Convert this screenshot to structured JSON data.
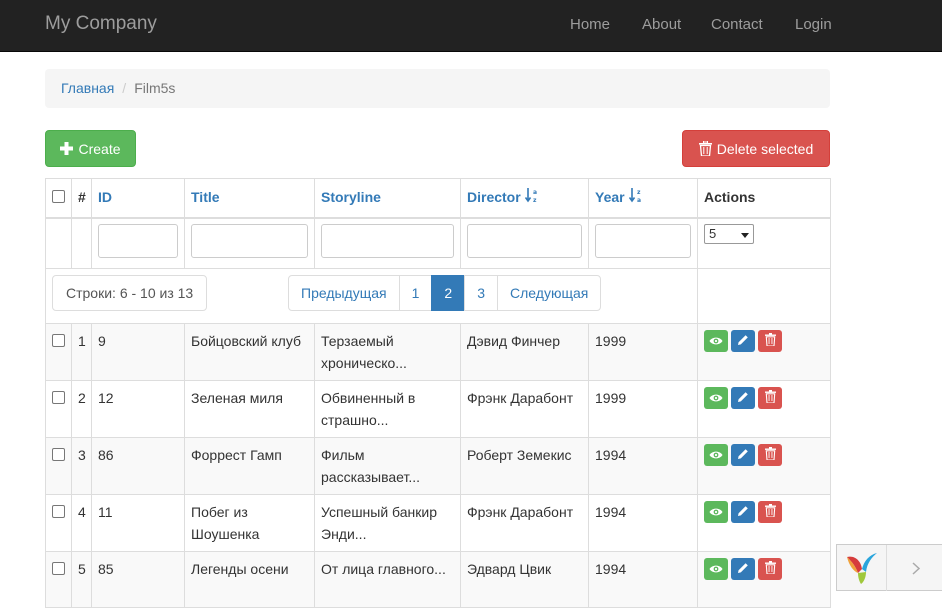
{
  "navbar": {
    "brand": "My Company",
    "links": [
      "Home",
      "About",
      "Contact",
      "Login"
    ]
  },
  "breadcrumb": {
    "home": "Главная",
    "current": "Film5s"
  },
  "toolbar": {
    "create_label": "Create",
    "delete_label": "Delete selected"
  },
  "table": {
    "headers": {
      "num": "#",
      "id": "ID",
      "title": "Title",
      "storyline": "Storyline",
      "director": "Director",
      "year": "Year",
      "actions": "Actions"
    },
    "page_size": "5",
    "summary": "Строки: 6 - 10 из 13",
    "pagination": {
      "prev": "Предыдущая",
      "pages": [
        "1",
        "2",
        "3"
      ],
      "active_page": "2",
      "next": "Следующая"
    },
    "rows": [
      {
        "num": "1",
        "id": "9",
        "title": "Бойцовский клуб",
        "storyline": "Терзаемый хроническо...",
        "director": "Дэвид Финчер",
        "year": "1999"
      },
      {
        "num": "2",
        "id": "12",
        "title": "Зеленая миля",
        "storyline": "Обвиненный в страшно...",
        "director": "Фрэнк Дарабонт",
        "year": "1999"
      },
      {
        "num": "3",
        "id": "86",
        "title": "Форрест Гамп",
        "storyline": "Фильм рассказывает...",
        "director": "Роберт Земекис",
        "year": "1994"
      },
      {
        "num": "4",
        "id": "11",
        "title": "Побег из Шоушенка",
        "storyline": "Успешный банкир Энди...",
        "director": "Фрэнк Дарабонт",
        "year": "1994"
      },
      {
        "num": "5",
        "id": "85",
        "title": "Легенды осени",
        "storyline": "От лица главного...",
        "director": "Эдвард Цвик",
        "year": "1994"
      }
    ]
  },
  "icons": {
    "create": "plus-icon",
    "delete": "trash-icon",
    "view": "eye-icon",
    "edit": "pencil-icon",
    "row_delete": "trash-icon",
    "sort": "sort-alpha-icon",
    "debug_logo": "yii-logo-icon",
    "debug_toggle": "chevron-right-icon"
  },
  "colors": {
    "navbar": "#222222",
    "success": "#5cb85c",
    "danger": "#d9534f",
    "primary": "#337ab7"
  }
}
